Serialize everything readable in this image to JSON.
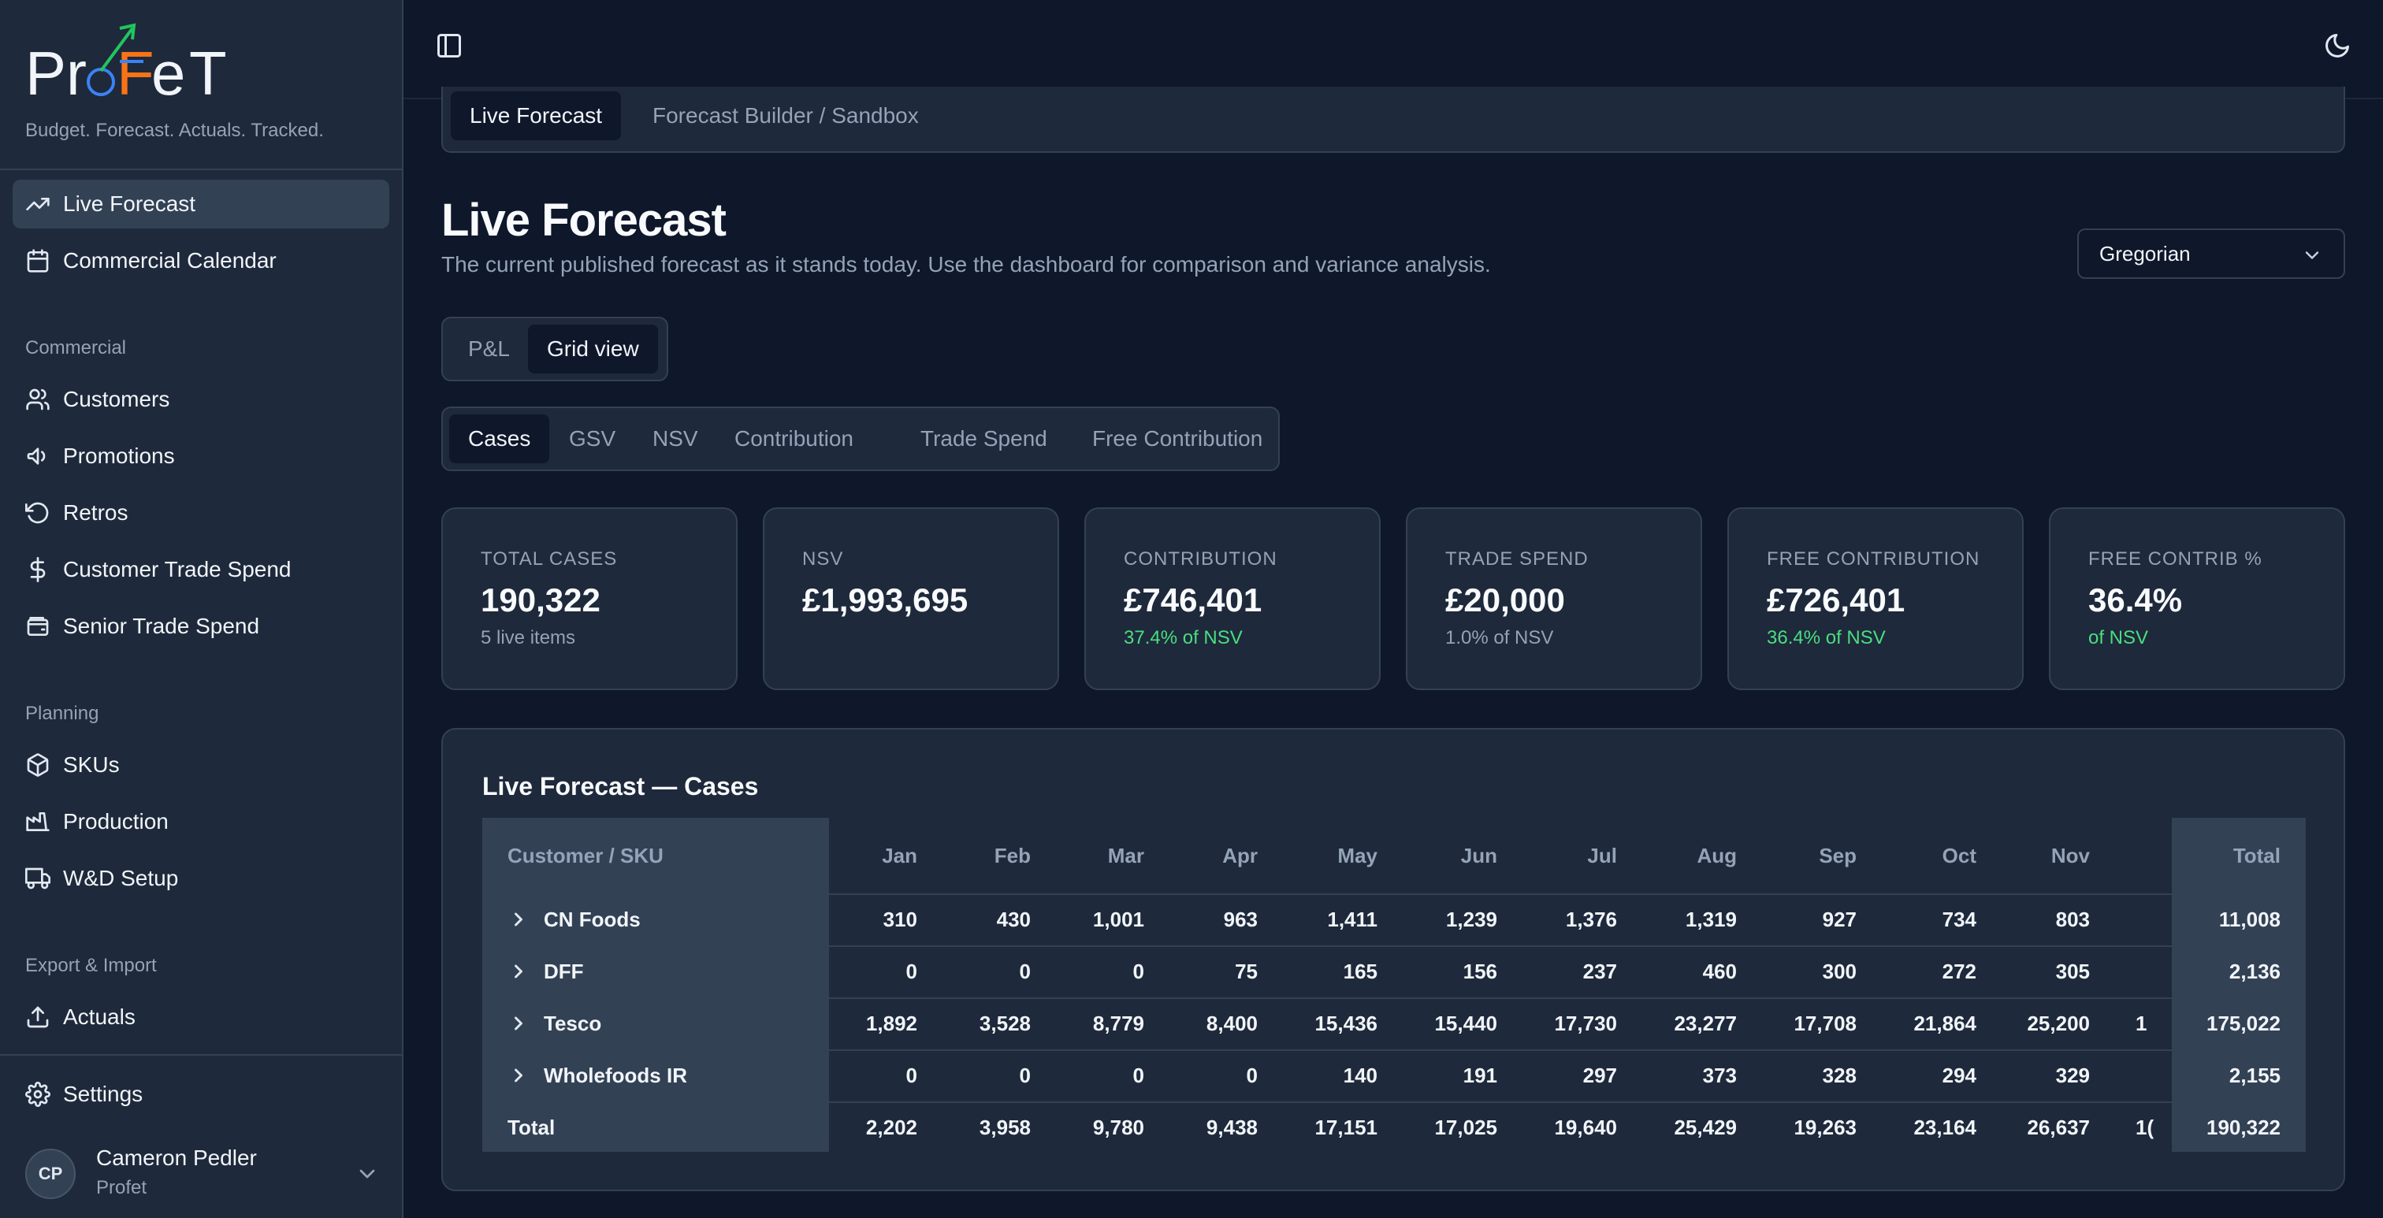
{
  "brand": {
    "name": "ProFeT",
    "tagline": "Budget. Forecast. Actuals. Tracked."
  },
  "sidebar": {
    "top_items": [
      {
        "label": "Live Forecast",
        "icon": "trending-up-icon",
        "active": true
      },
      {
        "label": "Commercial Calendar",
        "icon": "calendar-icon",
        "active": false
      }
    ],
    "sections": [
      {
        "label": "Commercial",
        "items": [
          {
            "label": "Customers",
            "icon": "users-icon"
          },
          {
            "label": "Promotions",
            "icon": "megaphone-icon"
          },
          {
            "label": "Retros",
            "icon": "rotate-ccw-icon"
          },
          {
            "label": "Customer Trade Spend",
            "icon": "dollar-sign-icon"
          },
          {
            "label": "Senior Trade Spend",
            "icon": "wallet-icon"
          }
        ]
      },
      {
        "label": "Planning",
        "items": [
          {
            "label": "SKUs",
            "icon": "box-icon"
          },
          {
            "label": "Production",
            "icon": "factory-icon"
          },
          {
            "label": "W&D Setup",
            "icon": "truck-icon"
          }
        ]
      },
      {
        "label": "Export & Import",
        "items": [
          {
            "label": "Actuals",
            "icon": "upload-icon"
          }
        ]
      }
    ],
    "settings_label": "Settings",
    "user": {
      "initials": "CP",
      "name": "Cameron Pedler",
      "org": "Profet"
    }
  },
  "top_tabs": [
    {
      "label": "Live Forecast",
      "active": true
    },
    {
      "label": "Forecast Builder / Sandbox",
      "active": false
    }
  ],
  "page": {
    "title": "Live Forecast",
    "subtitle": "The current published forecast as it stands today. Use the dashboard for comparison and variance analysis.",
    "calendar_value": "Gregorian"
  },
  "view_toggle": [
    {
      "label": "P&L",
      "active": false
    },
    {
      "label": "Grid view",
      "active": true
    }
  ],
  "metric_tabs": [
    {
      "label": "Cases",
      "active": true
    },
    {
      "label": "GSV",
      "active": false
    },
    {
      "label": "NSV",
      "active": false
    },
    {
      "label": "Contribution",
      "active": false
    },
    {
      "label": "Trade Spend",
      "active": false
    },
    {
      "label": "Free Contribution",
      "active": false
    }
  ],
  "kpis": [
    {
      "label": "TOTAL CASES",
      "value": "190,322",
      "sub": "5 live items",
      "sub_color": "muted"
    },
    {
      "label": "NSV",
      "value": "£1,993,695",
      "sub": "",
      "sub_color": "muted"
    },
    {
      "label": "CONTRIBUTION",
      "value": "£746,401",
      "sub": "37.4% of NSV",
      "sub_color": "green"
    },
    {
      "label": "TRADE SPEND",
      "value": "£20,000",
      "sub": "1.0% of NSV",
      "sub_color": "muted"
    },
    {
      "label": "FREE CONTRIBUTION",
      "value": "£726,401",
      "sub": "36.4% of NSV",
      "sub_color": "green"
    },
    {
      "label": "FREE CONTRIB %",
      "value": "36.4%",
      "sub": "of NSV",
      "sub_color": "green"
    }
  ],
  "table": {
    "title": "Live Forecast — Cases",
    "first_col_header": "Customer / SKU",
    "months": [
      "Jan",
      "Feb",
      "Mar",
      "Apr",
      "May",
      "Jun",
      "Jul",
      "Aug",
      "Sep",
      "Oct",
      "Nov"
    ],
    "total_header": "Total",
    "rows": [
      {
        "label": "CN Foods",
        "values": [
          "310",
          "430",
          "1,001",
          "963",
          "1,411",
          "1,239",
          "1,376",
          "1,319",
          "927",
          "734",
          "803"
        ],
        "overflow": "",
        "total": "11,008"
      },
      {
        "label": "DFF",
        "values": [
          "0",
          "0",
          "0",
          "75",
          "165",
          "156",
          "237",
          "460",
          "300",
          "272",
          "305"
        ],
        "overflow": "",
        "total": "2,136"
      },
      {
        "label": "Tesco",
        "values": [
          "1,892",
          "3,528",
          "8,779",
          "8,400",
          "15,436",
          "15,440",
          "17,730",
          "23,277",
          "17,708",
          "21,864",
          "25,200"
        ],
        "overflow": "1",
        "total": "175,022"
      },
      {
        "label": "Wholefoods IR",
        "values": [
          "0",
          "0",
          "0",
          "0",
          "140",
          "191",
          "297",
          "373",
          "328",
          "294",
          "329"
        ],
        "overflow": "",
        "total": "2,155"
      }
    ],
    "total_row": {
      "label": "Total",
      "values": [
        "2,202",
        "3,958",
        "9,780",
        "9,438",
        "17,151",
        "17,025",
        "19,640",
        "25,429",
        "19,263",
        "23,164",
        "26,637"
      ],
      "overflow": "1(",
      "total": "190,322"
    }
  },
  "colors": {
    "background": "#0f172a",
    "surface": "#1e293b",
    "border": "#334155",
    "muted": "#94a3b8",
    "positive": "#4ade80",
    "logo_orange": "#f97316",
    "logo_blue": "#3b82f6",
    "logo_green": "#22c55e"
  }
}
